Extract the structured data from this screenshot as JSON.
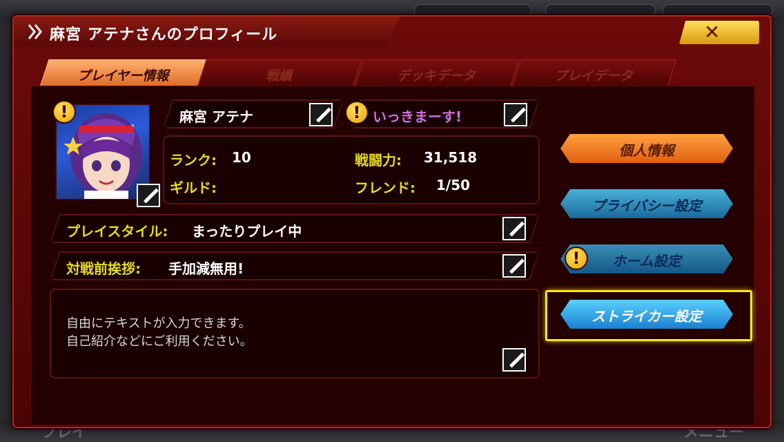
{
  "window": {
    "title": "麻宮 アテナさんのプロフィール",
    "close_label": "✕"
  },
  "tabs": [
    {
      "label": "プレイヤー情報",
      "active": true
    },
    {
      "label": "戦績",
      "active": false
    },
    {
      "label": "デッキデータ",
      "active": false
    },
    {
      "label": "プレイデータ",
      "active": false
    }
  ],
  "profile": {
    "name": "麻宮 アテナ",
    "catchphrase": "いっきまーす!",
    "rank_label": "ランク:",
    "rank_value": "10",
    "power_label": "戦闘力:",
    "power_value": "31,518",
    "guild_label": "ギルド:",
    "guild_value": "",
    "friend_label": "フレンド:",
    "friend_value": "1/50",
    "playstyle_label": "プレイスタイル:",
    "playstyle_value": "まったりプレイ中",
    "greeting_label": "対戦前挨拶:",
    "greeting_value": "手加減無用!",
    "bio_line1": "自由にテキストが入力できます。",
    "bio_line2": "自己紹介などにご利用ください。"
  },
  "side_buttons": [
    {
      "label": "個人情報"
    },
    {
      "label": "プライバシー設定"
    },
    {
      "label": "ホーム設定"
    },
    {
      "label": "ストライカー設定"
    }
  ],
  "background": {
    "bottom_left": "プレイ",
    "bottom_right": "メニュー"
  },
  "icons": {
    "alert": "!",
    "edit": "pencil"
  },
  "colors": {
    "panel": "#4a0404",
    "accent_active_tab": "#f08030",
    "highlight": "#ffe81a",
    "stat_label": "#e6dc20",
    "catchphrase": "#d070e0"
  }
}
